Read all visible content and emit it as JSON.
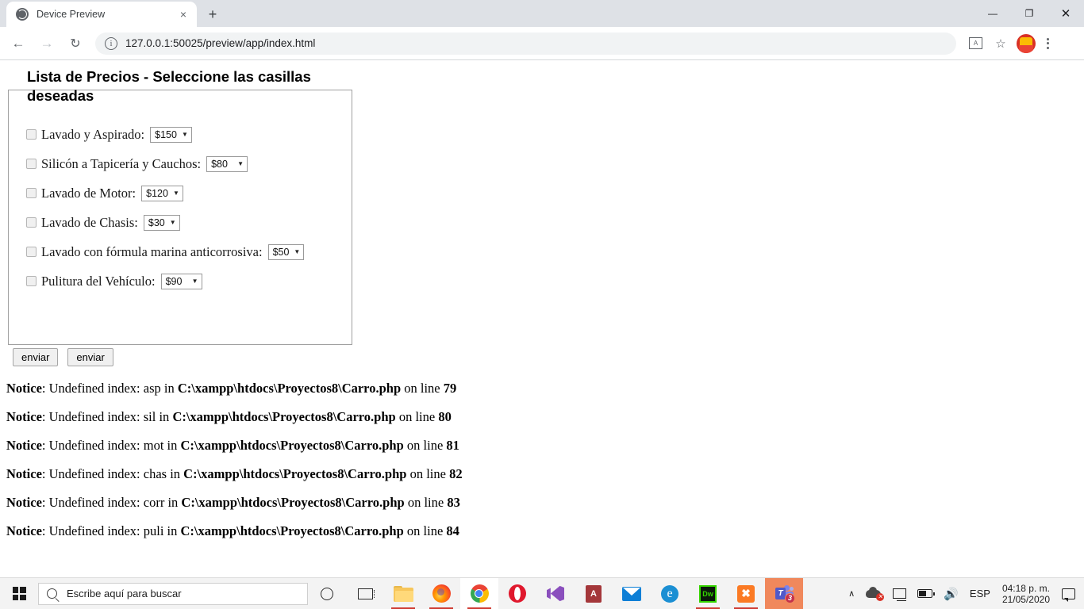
{
  "browser": {
    "tab": {
      "title": "Device Preview",
      "favicon": "globe-icon",
      "close": "×"
    },
    "newtab_label": "+",
    "window_controls": {
      "minimize": "—",
      "maximize": "❐",
      "close": "✕"
    },
    "nav": {
      "back": "←",
      "forward": "→",
      "reload": "↻"
    },
    "omnibox": {
      "url": "127.0.0.1:50025/preview/app/index.html",
      "info_icon": "i"
    },
    "toolbar_icons": {
      "translate": "文A",
      "bookmark": "☆",
      "avatar": "user-avatar",
      "menu": "three-dot-menu"
    }
  },
  "page": {
    "legend": "Lista de Precios - Seleccione las casillas deseadas",
    "items": [
      {
        "label": "Lavado y Aspirado:",
        "price": "$150",
        "size": "w-md"
      },
      {
        "label": "Silicón a Tapicería y Cauchos:",
        "price": "$80",
        "size": "w-md"
      },
      {
        "label": "Lavado de Motor:",
        "price": "$120",
        "size": "w-md"
      },
      {
        "label": "Lavado de Chasis:",
        "price": "$30",
        "size": "w-sm"
      },
      {
        "label": "Lavado con fórmula marina anticorrosiva:",
        "price": "$50",
        "size": "w-sm"
      },
      {
        "label": "Pulitura del Vehículo:",
        "price": "$90",
        "size": "w-md"
      }
    ],
    "arrow": "▼",
    "buttons": [
      {
        "label": "enviar"
      },
      {
        "label": "enviar"
      }
    ],
    "notices": [
      {
        "tag": "Notice",
        "sep": ": ",
        "message": "Undefined index: asp in ",
        "file": "C:\\xampp\\htdocs\\Proyectos8\\Carro.php",
        "online": " on line ",
        "line": "79"
      },
      {
        "tag": "Notice",
        "sep": ": ",
        "message": "Undefined index: sil in ",
        "file": "C:\\xampp\\htdocs\\Proyectos8\\Carro.php",
        "online": " on line ",
        "line": "80"
      },
      {
        "tag": "Notice",
        "sep": ": ",
        "message": "Undefined index: mot in ",
        "file": "C:\\xampp\\htdocs\\Proyectos8\\Carro.php",
        "online": " on line ",
        "line": "81"
      },
      {
        "tag": "Notice",
        "sep": ": ",
        "message": "Undefined index: chas in ",
        "file": "C:\\xampp\\htdocs\\Proyectos8\\Carro.php",
        "online": " on line ",
        "line": "82"
      },
      {
        "tag": "Notice",
        "sep": ": ",
        "message": "Undefined index: corr in ",
        "file": "C:\\xampp\\htdocs\\Proyectos8\\Carro.php",
        "online": " on line ",
        "line": "83"
      },
      {
        "tag": "Notice",
        "sep": ": ",
        "message": "Undefined index: puli in ",
        "file": "C:\\xampp\\htdocs\\Proyectos8\\Carro.php",
        "online": " on line ",
        "line": "84"
      }
    ]
  },
  "taskbar": {
    "start_icon": "windows-logo-icon",
    "search_placeholder": "Escribe aquí para buscar",
    "cortana_icon": "cortana-icon",
    "taskview_icon": "task-view-icon",
    "apps": [
      {
        "name": "file-explorer",
        "label": ""
      },
      {
        "name": "firefox",
        "label": ""
      },
      {
        "name": "google-chrome",
        "label": ""
      },
      {
        "name": "opera",
        "label": ""
      },
      {
        "name": "visual-studio-code",
        "label": ""
      },
      {
        "name": "microsoft-access",
        "label": "A"
      },
      {
        "name": "mail",
        "label": ""
      },
      {
        "name": "microsoft-edge",
        "label": "e"
      },
      {
        "name": "dreamweaver",
        "label": "Dw"
      },
      {
        "name": "xampp",
        "label": "✖"
      },
      {
        "name": "microsoft-teams",
        "label": "T",
        "badge": "3"
      }
    ],
    "tray": {
      "chevron": "∧",
      "onedrive_badge": "✕",
      "volume": "🔊",
      "language": "ESP",
      "time": "04:18 p. m.",
      "date": "21/05/2020"
    }
  }
}
